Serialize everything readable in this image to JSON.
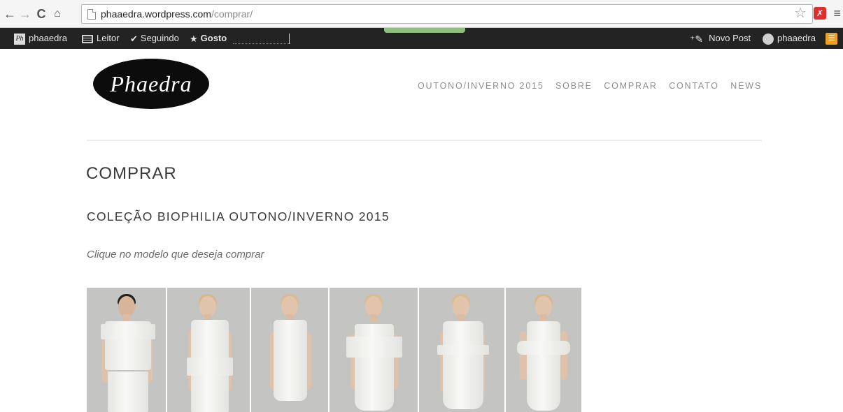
{
  "browser": {
    "url_host": "phaaedra.wordpress.com",
    "url_path": "/comprar/",
    "icons": [
      "back-arrow-icon",
      "forward-arrow-icon",
      "reload-icon",
      "home-icon",
      "page-icon",
      "bookmark-star-icon",
      "extension-icon",
      "menu-icon"
    ]
  },
  "adminbar": {
    "site_name": "phaaedra",
    "reader": "Leitor",
    "following": "Seguindo",
    "likes": "Gosto",
    "new_post": "Novo Post",
    "user": "phaaedra"
  },
  "site": {
    "logo_text": "Phaedra",
    "nav": [
      "OUTONO/INVERNO 2015",
      "SOBRE",
      "COMPRAR",
      "CONTATO",
      "NEWS"
    ]
  },
  "content": {
    "title": "COMPRAR",
    "collection_title": "COLEÇÃO BIOPHILIA OUTONO/INVERNO 2015",
    "intro": "Clique no modelo que deseja comprar"
  },
  "gallery": {
    "count": 6,
    "items": [
      "look-1",
      "look-2",
      "look-3",
      "look-4",
      "look-5",
      "look-6"
    ]
  }
}
